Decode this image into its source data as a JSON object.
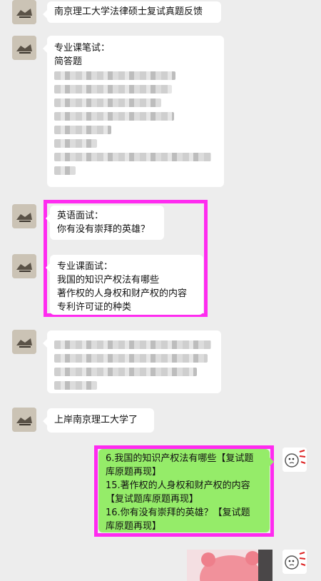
{
  "messages": {
    "m1": {
      "text": "南京理工大学法律硕士复试真题反馈"
    },
    "m2": {
      "lines": [
        "专业课笔试：",
        "简答题"
      ],
      "blurred_count": 8
    },
    "m3": {
      "lines": [
        "英语面试：",
        "你有没有崇拜的英雄？"
      ]
    },
    "m4": {
      "lines": [
        "专业课面试：",
        "我国的知识产权法有哪些",
        "著作权的人身权和财产权的内容",
        "专利许可证的种类"
      ]
    },
    "m5": {
      "blurred_count": 4
    },
    "m6": {
      "text": "上岸南京理工大学了"
    },
    "m7": {
      "lines": [
        "6.我国的知识产权法有哪些【复试题",
        "库原题再现】",
        "15.著作权的人身权和财产权的内容",
        "【复试题库原题再现】",
        "16.你有没有崇拜的英雄？【复试题",
        "库原题再现】"
      ]
    }
  },
  "colors": {
    "background": "#ededed",
    "sent_bubble": "#95ec69",
    "received_bubble": "#ffffff",
    "highlight_border": "#ff2bf0"
  },
  "icons": {
    "avatar": "user-avatar-icon",
    "self_avatar": "self-avatar-icon"
  }
}
